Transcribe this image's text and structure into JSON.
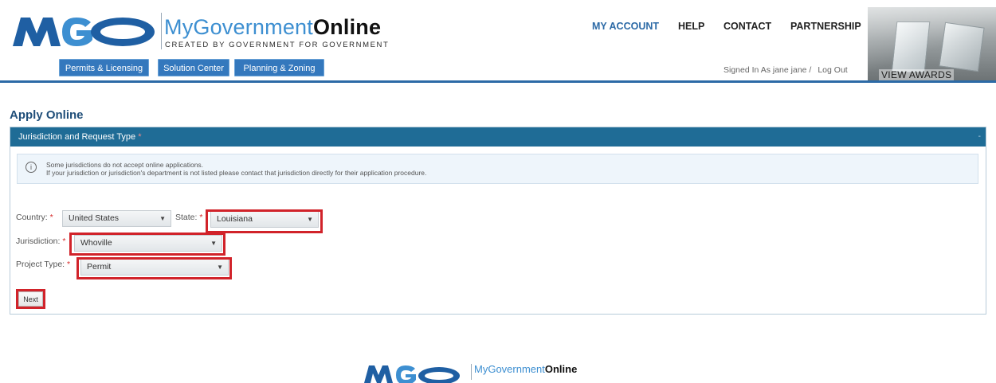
{
  "brand": {
    "name_part1": "MyGovernment",
    "name_part2": "Online",
    "tagline": "CREATED BY GOVERNMENT FOR GOVERNMENT",
    "logo_text": "MGO"
  },
  "top_nav": {
    "my_account": "MY ACCOUNT",
    "help": "HELP",
    "contact": "CONTACT",
    "partnership": "PARTNERSHIP"
  },
  "modules": {
    "permits": "Permits & Licensing",
    "solution": "Solution Center",
    "planning": "Planning & Zoning"
  },
  "user": {
    "signed_in": "Signed In As jane jane /",
    "logout": "Log Out"
  },
  "awards": {
    "label": "VIEW AWARDS"
  },
  "page": {
    "title": "Apply Online"
  },
  "panel": {
    "title": "Jurisdiction and Request Type",
    "required_mark": "*",
    "collapse_glyph": "-"
  },
  "notice": {
    "icon": "i",
    "line1": "Some jurisdictions do not accept online applications.",
    "line2": "If your jurisdiction or jurisdiction's department is not listed please contact that jurisdiction directly for their application procedure."
  },
  "form": {
    "country_label": "Country:",
    "country_value": "United States",
    "state_label": "State:",
    "state_value": "Louisiana",
    "jurisdiction_label": "Jurisdiction:",
    "jurisdiction_value": "Whoville",
    "project_label": "Project Type:",
    "project_value": "Permit",
    "required_mark": "*",
    "caret": "▼",
    "next_label": "Next"
  },
  "colors": {
    "brand_blue": "#3d8fd1",
    "nav_active": "#2c6aa6",
    "panel_header": "#1f6c96",
    "highlight_red": "#d1232a"
  }
}
